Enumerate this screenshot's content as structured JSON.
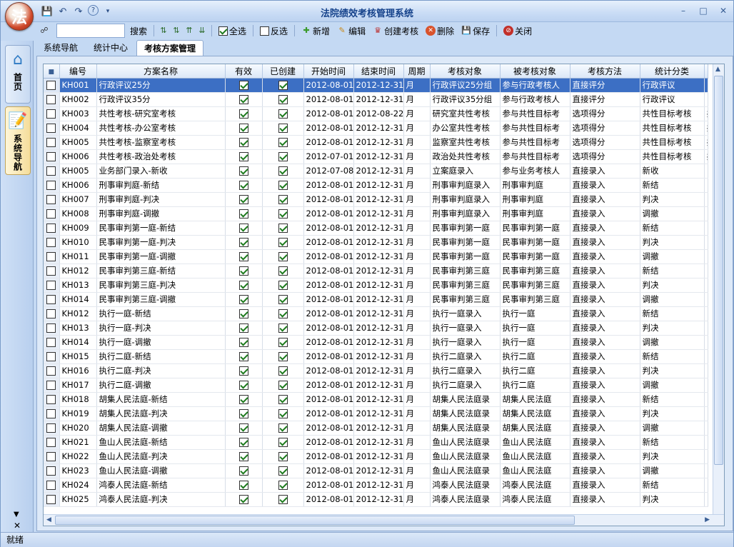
{
  "app": {
    "title": "法院绩效考核管理系统",
    "logo_char": "法"
  },
  "toolbar": {
    "search_label": "搜索",
    "select_all": "全选",
    "invert": "反选",
    "add": "新增",
    "edit": "编辑",
    "create": "创建考核",
    "delete": "删除",
    "save": "保存",
    "close": "关闭",
    "select_all_checked": true,
    "invert_checked": false
  },
  "nav": {
    "home": "首页",
    "system": "系统导航"
  },
  "tabs": [
    {
      "label": "系统导航"
    },
    {
      "label": "统计中心"
    },
    {
      "label": "考核方案管理",
      "active": true
    }
  ],
  "grid": {
    "columns": [
      "",
      "编号",
      "方案名称",
      "有效",
      "已创建",
      "开始时间",
      "结束时间",
      "周期",
      "考核对象",
      "被考核对象",
      "考核方法",
      "统计分类"
    ],
    "rows": [
      [
        "KH001",
        "行政评议25分",
        "2012-08-01",
        "2012-12-31",
        "月",
        "行政评议25分组",
        "参与行政考核人",
        "直接评分",
        "行政评议",
        ""
      ],
      [
        "KH002",
        "行政评议35分",
        "2012-08-01",
        "2012-12-31",
        "月",
        "行政评议35分组",
        "参与行政考核人",
        "直接评分",
        "行政评议",
        ""
      ],
      [
        "KH003",
        "共性考核-研究室考核",
        "2012-08-01",
        "2012-08-22",
        "月",
        "研究室共性考核",
        "参与共性目标考",
        "选项得分",
        "共性目标考核",
        "共"
      ],
      [
        "KH004",
        "共性考核-办公室考核",
        "2012-08-01",
        "2012-12-31",
        "月",
        "办公室共性考核",
        "参与共性目标考",
        "选项得分",
        "共性目标考核",
        "共"
      ],
      [
        "KH005",
        "共性考核-监察室考核",
        "2012-08-01",
        "2012-12-31",
        "月",
        "监察室共性考核",
        "参与共性目标考",
        "选项得分",
        "共性目标考核",
        "共"
      ],
      [
        "KH006",
        "共性考核-政治处考核",
        "2012-07-01",
        "2012-12-31",
        "月",
        "政治处共性考核",
        "参与共性目标考",
        "选项得分",
        "共性目标考核",
        "共"
      ],
      [
        "KH005",
        "业务部门录入-新收",
        "2012-07-08",
        "2012-12-31",
        "月",
        "立案庭录入",
        "参与业务考核人",
        "直接录入",
        "新收",
        ""
      ],
      [
        "KH006",
        "刑事审判庭-新结",
        "2012-08-01",
        "2012-12-31",
        "月",
        "刑事审判庭录入",
        "刑事审判庭",
        "直接录入",
        "新结",
        ""
      ],
      [
        "KH007",
        "刑事审判庭-判决",
        "2012-08-01",
        "2012-12-31",
        "月",
        "刑事审判庭录入",
        "刑事审判庭",
        "直接录入",
        "判决",
        ""
      ],
      [
        "KH008",
        "刑事审判庭-调撤",
        "2012-08-01",
        "2012-12-31",
        "月",
        "刑事审判庭录入",
        "刑事审判庭",
        "直接录入",
        "调撤",
        ""
      ],
      [
        "KH009",
        "民事审判第一庭-新结",
        "2012-08-01",
        "2012-12-31",
        "月",
        "民事审判第一庭",
        "民事审判第一庭",
        "直接录入",
        "新结",
        ""
      ],
      [
        "KH010",
        "民事审判第一庭-判决",
        "2012-08-01",
        "2012-12-31",
        "月",
        "民事审判第一庭",
        "民事审判第一庭",
        "直接录入",
        "判决",
        ""
      ],
      [
        "KH011",
        "民事审判第一庭-调撤",
        "2012-08-01",
        "2012-12-31",
        "月",
        "民事审判第一庭",
        "民事审判第一庭",
        "直接录入",
        "调撤",
        ""
      ],
      [
        "KH012",
        "民事审判第三庭-新结",
        "2012-08-01",
        "2012-12-31",
        "月",
        "民事审判第三庭",
        "民事审判第三庭",
        "直接录入",
        "新结",
        ""
      ],
      [
        "KH013",
        "民事审判第三庭-判决",
        "2012-08-01",
        "2012-12-31",
        "月",
        "民事审判第三庭",
        "民事审判第三庭",
        "直接录入",
        "判决",
        ""
      ],
      [
        "KH014",
        "民事审判第三庭-调撤",
        "2012-08-01",
        "2012-12-31",
        "月",
        "民事审判第三庭",
        "民事审判第三庭",
        "直接录入",
        "调撤",
        ""
      ],
      [
        "KH012",
        "执行一庭-新结",
        "2012-08-01",
        "2012-12-31",
        "月",
        "执行一庭录入",
        "执行一庭",
        "直接录入",
        "新结",
        ""
      ],
      [
        "KH013",
        "执行一庭-判决",
        "2012-08-01",
        "2012-12-31",
        "月",
        "执行一庭录入",
        "执行一庭",
        "直接录入",
        "判决",
        ""
      ],
      [
        "KH014",
        "执行一庭-调撤",
        "2012-08-01",
        "2012-12-31",
        "月",
        "执行一庭录入",
        "执行一庭",
        "直接录入",
        "调撤",
        ""
      ],
      [
        "KH015",
        "执行二庭-新结",
        "2012-08-01",
        "2012-12-31",
        "月",
        "执行二庭录入",
        "执行二庭",
        "直接录入",
        "新结",
        ""
      ],
      [
        "KH016",
        "执行二庭-判决",
        "2012-08-01",
        "2012-12-31",
        "月",
        "执行二庭录入",
        "执行二庭",
        "直接录入",
        "判决",
        ""
      ],
      [
        "KH017",
        "执行二庭-调撤",
        "2012-08-01",
        "2012-12-31",
        "月",
        "执行二庭录入",
        "执行二庭",
        "直接录入",
        "调撤",
        ""
      ],
      [
        "KH018",
        "胡集人民法庭-新结",
        "2012-08-01",
        "2012-12-31",
        "月",
        "胡集人民法庭录",
        "胡集人民法庭",
        "直接录入",
        "新结",
        ""
      ],
      [
        "KH019",
        "胡集人民法庭-判决",
        "2012-08-01",
        "2012-12-31",
        "月",
        "胡集人民法庭录",
        "胡集人民法庭",
        "直接录入",
        "判决",
        ""
      ],
      [
        "KH020",
        "胡集人民法庭-调撤",
        "2012-08-01",
        "2012-12-31",
        "月",
        "胡集人民法庭录",
        "胡集人民法庭",
        "直接录入",
        "调撤",
        ""
      ],
      [
        "KH021",
        "鱼山人民法庭-新结",
        "2012-08-01",
        "2012-12-31",
        "月",
        "鱼山人民法庭录",
        "鱼山人民法庭",
        "直接录入",
        "新结",
        ""
      ],
      [
        "KH022",
        "鱼山人民法庭-判决",
        "2012-08-01",
        "2012-12-31",
        "月",
        "鱼山人民法庭录",
        "鱼山人民法庭",
        "直接录入",
        "判决",
        ""
      ],
      [
        "KH023",
        "鱼山人民法庭-调撤",
        "2012-08-01",
        "2012-12-31",
        "月",
        "鱼山人民法庭录",
        "鱼山人民法庭",
        "直接录入",
        "调撤",
        ""
      ],
      [
        "KH024",
        "鸿泰人民法庭-新结",
        "2012-08-01",
        "2012-12-31",
        "月",
        "鸿泰人民法庭录",
        "鸿泰人民法庭",
        "直接录入",
        "新结",
        ""
      ],
      [
        "KH025",
        "鸿泰人民法庭-判决",
        "2012-08-01",
        "2012-12-31",
        "月",
        "鸿泰人民法庭录",
        "鸿泰人民法庭",
        "直接录入",
        "判决",
        ""
      ]
    ],
    "selected_row": 0
  },
  "status": {
    "text": "就绪"
  },
  "colors": {
    "selection": "#3c6fc4",
    "titlebar": "#c9dcf5",
    "title_text": "#15428b"
  }
}
